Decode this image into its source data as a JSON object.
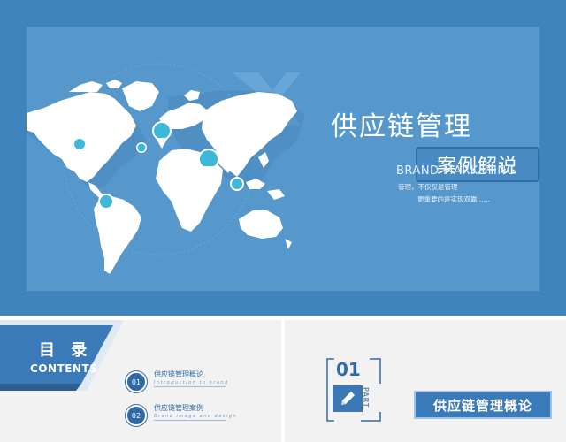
{
  "cover": {
    "title": "供应链管理",
    "subtitle": "案例解说",
    "brand": "BRAND MARKETING",
    "line1": "管理，不仅仅是管理",
    "line2": "更重要的是实现双赢......"
  },
  "toc": {
    "title": "目 录",
    "contents_label": "CONTENTS",
    "items": [
      {
        "num": "01",
        "label": "供应链管理概论",
        "desc": "Introduction to brand"
      },
      {
        "num": "02",
        "label": "供应链管理案例",
        "desc": "Brand image and design"
      }
    ]
  },
  "part": {
    "num": "01",
    "word": "PART",
    "title": "供应链管理概论"
  },
  "colors": {
    "frame_blue": "#3f84bd",
    "panel_blue": "#5698cc",
    "dark_blue": "#2f6aa6",
    "light_gray": "#f2f2f2",
    "marker_cyan": "#3fb8d8"
  },
  "icons": [
    "map-pin-icon",
    "pencil-icon",
    "world-map-icon"
  ]
}
